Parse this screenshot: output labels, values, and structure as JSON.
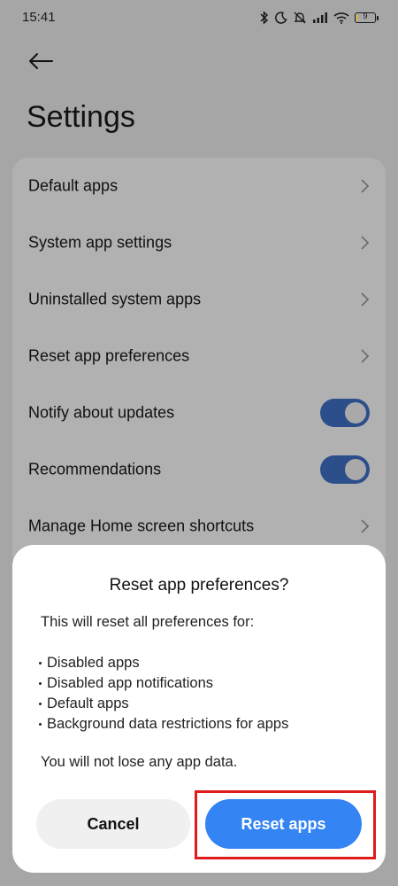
{
  "status_bar": {
    "time": "15:41",
    "battery_level": "9",
    "icons": [
      "bluetooth-icon",
      "moon-icon",
      "mute-icon",
      "signal-icon",
      "wifi-icon",
      "battery-icon"
    ]
  },
  "header": {
    "back_icon": "arrow-left-icon",
    "title": "Settings"
  },
  "settings": {
    "items": [
      {
        "label": "Default apps",
        "control": "chevron"
      },
      {
        "label": "System app settings",
        "control": "chevron"
      },
      {
        "label": "Uninstalled system apps",
        "control": "chevron"
      },
      {
        "label": "Reset app preferences",
        "control": "chevron"
      },
      {
        "label": "Notify about updates",
        "control": "toggle",
        "on": true
      },
      {
        "label": "Recommendations",
        "control": "toggle",
        "on": true
      },
      {
        "label": "Manage Home screen shortcuts",
        "control": "chevron"
      }
    ]
  },
  "dialog": {
    "title": "Reset app preferences?",
    "intro": "This will reset all preferences for:",
    "list": [
      "Disabled apps",
      "Disabled app notifications",
      "Default apps",
      "Background data restrictions for apps"
    ],
    "note": "You will not lose any app data.",
    "cancel_label": "Cancel",
    "confirm_label": "Reset apps"
  },
  "colors": {
    "accent": "#3484f3",
    "highlight": "#e01b1b",
    "toggle_on": "#2c4f8c"
  }
}
